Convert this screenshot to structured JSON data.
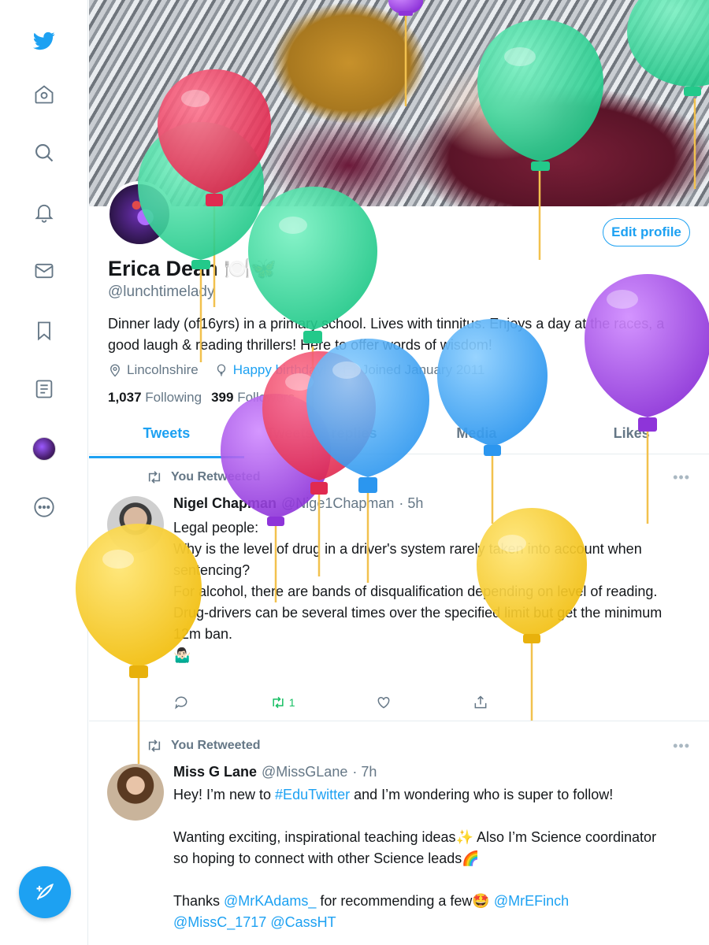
{
  "nav": {
    "items": [
      "twitter-logo",
      "home",
      "explore",
      "notifications",
      "messages",
      "bookmarks",
      "lists",
      "profile",
      "more"
    ]
  },
  "profile": {
    "name": "Erica Dean 🍽️🦋",
    "handle": "@lunchtimelady",
    "edit_label": "Edit profile",
    "bio": "Dinner lady (of16yrs) in a primary school. Lives with tinnitus. Enjoys a day at the races, a good laugh & reading thrillers! Here to offer words of wisdom!",
    "location": "Lincolnshire",
    "birthday": "Happy birthday!",
    "joined": "Joined January 2011",
    "following_count": "1,037",
    "following_label": "Following",
    "followers_count": "399",
    "followers_label": "Followers"
  },
  "tabs": [
    "Tweets",
    "Tweets & replies",
    "Media",
    "Likes"
  ],
  "tweets": [
    {
      "retweet_label": "You Retweeted",
      "name": "Nigel Chapman",
      "handle": "@Nige1Chapman",
      "time": "· 5h",
      "body": "Legal people:\nWhy is the level of drug in a driver's system rarely taken into account when sentencing?\nFor alcohol, there are bands of disqualification depending on level of reading.\nDrug-drivers can be several times over the specified limit but get the minimum 12m ban.\n🤷🏻‍♂️",
      "retweets": "1"
    },
    {
      "retweet_label": "You Retweeted",
      "name": "Miss G Lane",
      "handle": "@MissGLane",
      "time": "· 7h",
      "body_pre": "Hey! I’m new to ",
      "hashtag": "#EduTwitter",
      "body_mid": " and I’m wondering who is super to follow!\n\nWanting exciting, inspirational teaching ideas✨ Also I’m Science coordinator so hoping to connect with other Science leads🌈\n\nThanks ",
      "mention1": "@MrKAdams_",
      "body_mid2": " for recommending a few🤩 ",
      "mention2": "@MrEFinch",
      "mention3": "@MissC_1717",
      "mention4": "@CassHT"
    }
  ],
  "more_glyph": "•••",
  "colors": {
    "accent": "#1da1f2",
    "retweet_green": "#17bf63",
    "balloon_red": "#e8375a",
    "balloon_green": "#2fd99a",
    "balloon_blue": "#3ea8f5",
    "balloon_purple": "#a24ae6",
    "balloon_yellow": "#f7c91f"
  }
}
